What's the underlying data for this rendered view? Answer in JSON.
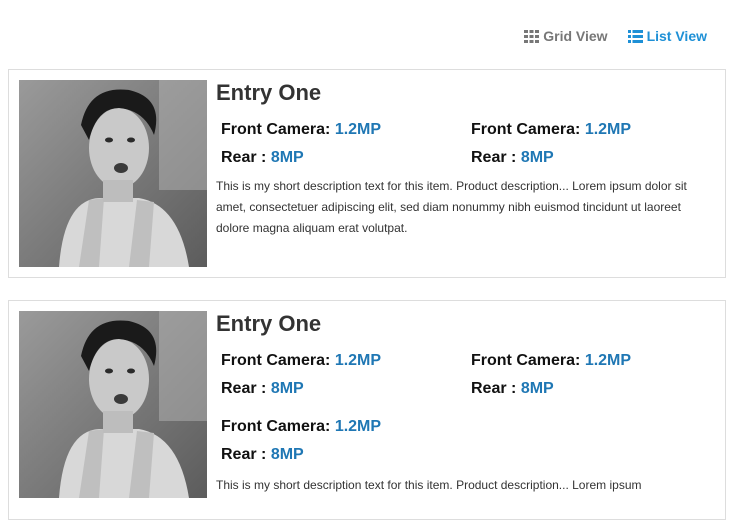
{
  "toolbar": {
    "grid_view": "Grid View",
    "list_view": "List View",
    "grid_icon": "grid-icon",
    "list_icon": "list-icon",
    "active_color": "#1e90d6",
    "inactive_color": "#777777"
  },
  "entries": [
    {
      "title": "Entry One",
      "specs": [
        {
          "label": "Front Camera:",
          "value": "1.2MP"
        },
        {
          "label": "Front Camera:",
          "value": "1.2MP"
        },
        {
          "label": "Rear :",
          "value": "8MP"
        },
        {
          "label": "Rear :",
          "value": "8MP"
        }
      ],
      "description": "This is my short description text for this item. Product description... Lorem ipsum dolor sit amet, consectetuer adipiscing elit, sed diam nonummy nibh euismod tincidunt ut laoreet dolore magna aliquam erat volutpat."
    },
    {
      "title": "Entry One",
      "specs": [
        {
          "label": "Front Camera:",
          "value": "1.2MP"
        },
        {
          "label": "Front Camera:",
          "value": "1.2MP"
        },
        {
          "label": "Rear :",
          "value": "8MP"
        },
        {
          "label": "Rear :",
          "value": "8MP"
        }
      ],
      "extra_specs": [
        {
          "label": "Front Camera:",
          "value": "1.2MP"
        },
        {
          "label": "Rear :",
          "value": "8MP"
        }
      ],
      "description": "This is my short description text for this item. Product description... Lorem ipsum"
    }
  ]
}
